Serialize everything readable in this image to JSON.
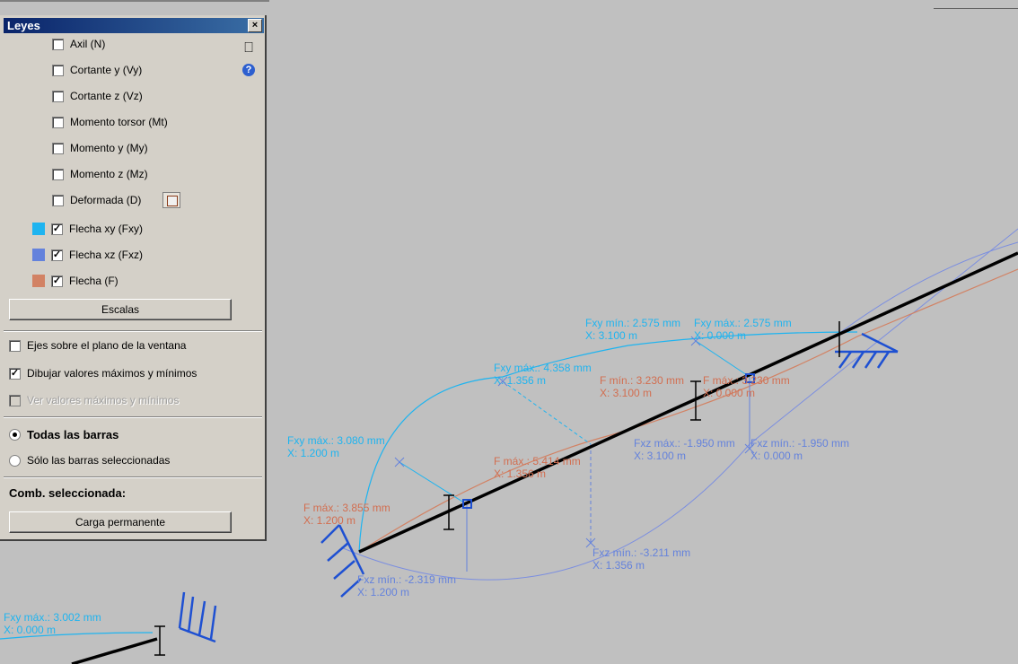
{
  "panel": {
    "title": "Leyes",
    "close_label": "×",
    "help_label": "?",
    "laws": [
      {
        "label": "Axil (N)",
        "checked": false
      },
      {
        "label": "Cortante y (Vy)",
        "checked": false
      },
      {
        "label": "Cortante z (Vz)",
        "checked": false
      },
      {
        "label": "Momento torsor (Mt)",
        "checked": false
      },
      {
        "label": "Momento y (My)",
        "checked": false
      },
      {
        "label": "Momento z (Mz)",
        "checked": false
      },
      {
        "label": "Deformada (D)",
        "checked": false
      }
    ],
    "deflections": [
      {
        "label": "Flecha xy (Fxy)",
        "checked": true,
        "color": "#1eb4f0"
      },
      {
        "label": "Flecha xz (Fxz)",
        "checked": true,
        "color": "#6482dc"
      },
      {
        "label": "Flecha (F)",
        "checked": true,
        "color": "#d28264"
      }
    ],
    "scales_button": "Escalas",
    "options": [
      {
        "label": "Ejes sobre el plano de la ventana",
        "checked": false,
        "enabled": true
      },
      {
        "label": "Dibujar valores máximos y mínimos",
        "checked": true,
        "enabled": true
      },
      {
        "label": "Ver valores máximos y mínimos",
        "checked": false,
        "enabled": false
      }
    ],
    "scope": [
      {
        "label": "Todas las barras",
        "selected": true
      },
      {
        "label": "Sólo las barras seleccionadas",
        "selected": false
      }
    ],
    "combination_label": "Comb. seleccionada:",
    "combination_button": "Carga permanente",
    "check_mark": "✓"
  },
  "viewport": {
    "labels": {
      "fxy_min_1": "Fxy mín.: 2.575 mm",
      "fxy_min_1_x": "X: 3.100 m",
      "fxy_max_1": "Fxy máx.: 2.575 mm",
      "fxy_max_1_x": "X: 0.000 m",
      "fxy_max_2": "Fxy máx.: 4.358 mm",
      "fxy_max_2_x": "X: 1.356 m",
      "f_min_1": "F mín.: 3.230 mm",
      "f_min_1_x": "X: 3.100 m",
      "f_max_1": "F máx.: 3.230 mm",
      "f_max_1_x": "X: 0.000 m",
      "fxy_max_3": "Fxy máx.: 3.080 mm",
      "fxy_max_3_x": "X: 1.200 m",
      "f_max_2": "F máx.: 5.414 mm",
      "f_max_2_x": "X: 1.356 m",
      "fxz_max_1": "Fxz máx.: -1.950 mm",
      "fxz_max_1_x": "X: 3.100 m",
      "fxz_min_1": "Fxz mín.: -1.950 mm",
      "fxz_min_1_x": "X: 0.000 m",
      "f_max_3": "F máx.: 3.855 mm",
      "f_max_3_x": "X: 1.200 m",
      "fxz_min_2": "Fxz mín.: -3.211 mm",
      "fxz_min_2_x": "X: 1.356 m",
      "fxz_min_3": "Fxz mín.: -2.319 mm",
      "fxz_min_3_x": "X: 1.200 m",
      "fxy_max_4": "Fxy máx.: 3.002 mm",
      "fxy_max_4_x": "X: 0.000 m"
    },
    "colors": {
      "fxy": "#1eb4f0",
      "fxz": "#6482dc",
      "f": "#d28264",
      "bar": "#000000",
      "support": "#1e50d2"
    }
  }
}
